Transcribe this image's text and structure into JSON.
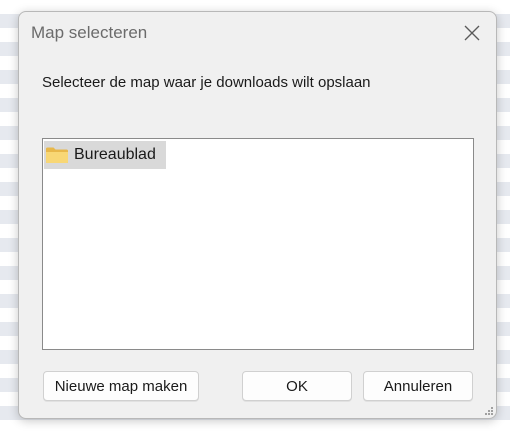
{
  "dialog": {
    "title": "Map selecteren",
    "prompt": "Selecteer de map waar je downloads wilt opslaan",
    "close_icon": "close-icon",
    "folders": [
      {
        "label": "Bureaublad",
        "icon": "folder-icon",
        "selected": true
      }
    ],
    "buttons": {
      "new_folder": "Nieuwe map maken",
      "ok": "OK",
      "cancel": "Annuleren"
    }
  },
  "colors": {
    "dialog_bg": "#f0f0f0",
    "selection": "#d9d9d9",
    "folder_yellow": "#f8d775"
  }
}
